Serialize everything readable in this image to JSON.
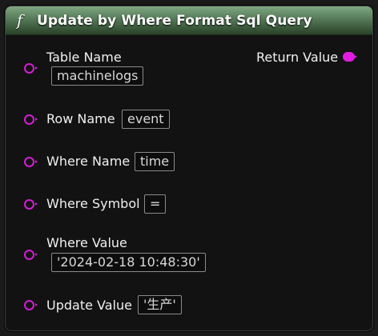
{
  "node": {
    "function_glyph": "f",
    "title": "Update by Where Format Sql Query"
  },
  "inputs": [
    {
      "label": "Table Name",
      "value": "machinelogs"
    },
    {
      "label": "Row Name",
      "value": "event"
    },
    {
      "label": "Where Name",
      "value": "time"
    },
    {
      "label": "Where Symbol",
      "value": "="
    },
    {
      "label": "Where Value",
      "value": "'2024-02-18 10:48:30'"
    },
    {
      "label": "Update Value",
      "value": "'生产'"
    }
  ],
  "outputs": [
    {
      "label": "Return Value"
    }
  ],
  "colors": {
    "header": "#557a58",
    "pin": "#d31ed3"
  }
}
